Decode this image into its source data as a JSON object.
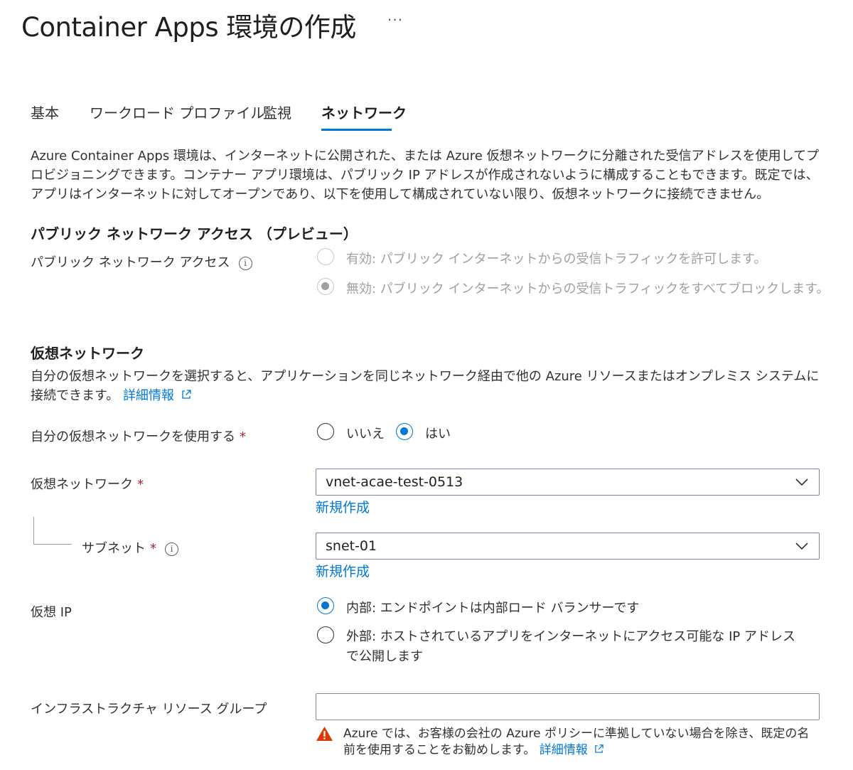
{
  "header": {
    "title": "Container Apps 環境の作成",
    "more": "···"
  },
  "tabs": [
    {
      "label": "基本"
    },
    {
      "label": "ワークロード プロファイル"
    },
    {
      "label": "監視"
    },
    {
      "label": "ネットワーク"
    }
  ],
  "intro": "Azure Container Apps 環境は、インターネットに公開された、または Azure 仮想ネットワークに分離された受信アドレスを使用してプロビジョニングできます。コンテナー アプリ環境は、パブリック IP アドレスが作成されないように構成することもできます。既定では、アプリはインターネットに対してオープンであり、以下を使用して構成されていない限り、仮想ネットワークに接続できません。",
  "public_access": {
    "heading": "パブリック ネットワーク アクセス （プレビュー）",
    "label": "パブリック ネットワーク アクセス",
    "info": "i",
    "options": [
      {
        "label": "有効: パブリック インターネットからの受信トラフィックを許可します。",
        "checked": false
      },
      {
        "label": "無効: パブリック インターネットからの受信トラフィックをすべてブロックします。",
        "checked": true
      }
    ]
  },
  "vnet_section": {
    "heading": "仮想ネットワーク",
    "desc": "自分の仮想ネットワークを選択すると、アプリケーションを同じネットワーク経由で他の Azure リソースまたはオンプレミス システムに接続できます。",
    "learn_more": "詳細情報"
  },
  "own_vnet": {
    "label": "自分の仮想ネットワークを使用する",
    "required": "*",
    "no_label": "いいえ",
    "yes_label": "はい",
    "selected": "はい"
  },
  "vnet": {
    "label": "仮想ネットワーク",
    "required": "*",
    "value": "vnet-acae-test-0513",
    "create_new": "新規作成"
  },
  "subnet": {
    "label": "サブネット",
    "required": "*",
    "info": "i",
    "value": "snet-01",
    "create_new": "新規作成"
  },
  "virtual_ip": {
    "label": "仮想 IP",
    "internal_label": "内部: エンドポイントは内部ロード バランサーです",
    "external_label": "外部: ホストされているアプリをインターネットにアクセス可能な IP アドレスで公開します",
    "selected": "内部"
  },
  "infra_rg": {
    "label": "インフラストラクチャ リソース グループ",
    "value": "",
    "warning": "Azure では、お客様の会社の Azure ポリシーに準拠していない場合を除き、既定の名前を使用することをお勧めします。",
    "learn_more": "詳細情報"
  },
  "colors": {
    "accent": "#0078d4",
    "required": "#a4262c",
    "warning": "#d83b01",
    "disabled": "#a19f9d"
  }
}
